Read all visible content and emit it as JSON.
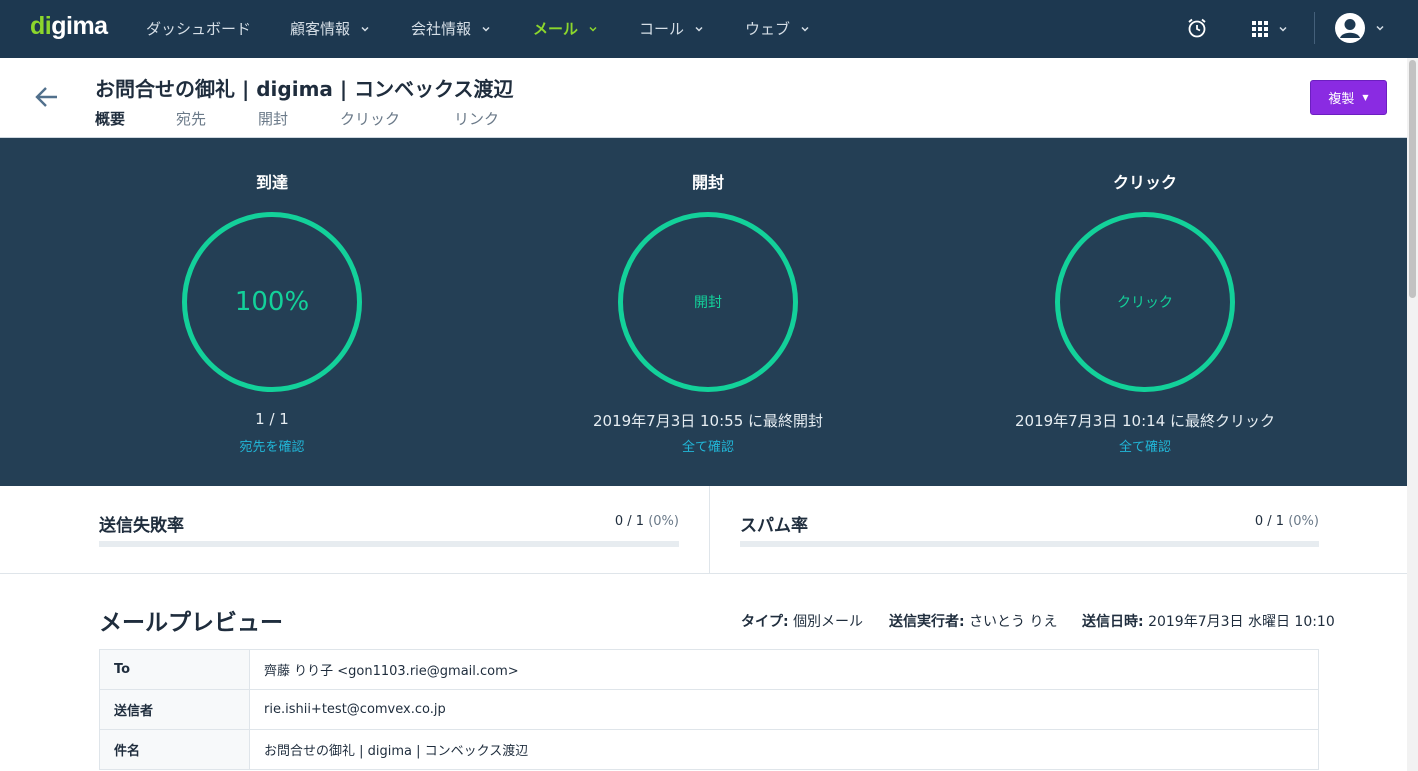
{
  "app": {
    "logo_prefix": "d",
    "logo_accent": "i",
    "logo_rest": "gima",
    "colors": {
      "nav_bg": "#1d3850",
      "accent_green": "#8cd72c",
      "ring": "#13d19a",
      "panel_bg": "#243f55",
      "button_purple": "#8a2be2",
      "link": "#21b6d7"
    }
  },
  "nav": {
    "items": [
      {
        "label": "ダッシュボード",
        "dropdown": false
      },
      {
        "label": "顧客情報",
        "dropdown": true
      },
      {
        "label": "会社情報",
        "dropdown": true
      },
      {
        "label": "メール",
        "dropdown": true,
        "active": true
      },
      {
        "label": "コール",
        "dropdown": true
      },
      {
        "label": "ウェブ",
        "dropdown": true
      }
    ],
    "icons": [
      "alarm-clock-icon",
      "apps-grid-icon",
      "chevron-down-icon",
      "user-avatar-icon",
      "chevron-down-icon"
    ]
  },
  "header": {
    "title": "お問合せの御礼 | digima | コンベックス渡辺",
    "tabs": [
      "概要",
      "宛先",
      "開封",
      "クリック",
      "リンク"
    ],
    "active_tab": "概要",
    "duplicate_button": "複製"
  },
  "stats": [
    {
      "title": "到達",
      "ring_label": "100%",
      "sub": "1 / 1",
      "link": "宛先を確認"
    },
    {
      "title": "開封",
      "ring_label": "開封",
      "sub": "2019年7月3日 10:55 に最終開封",
      "link": "全て確認"
    },
    {
      "title": "クリック",
      "ring_label": "クリック",
      "sub": "2019年7月3日 10:14 に最終クリック",
      "link": "全て確認"
    }
  ],
  "rates": [
    {
      "title": "送信失敗率",
      "value": "0 / 1",
      "percent": "(0%)",
      "fraction": 0
    },
    {
      "title": "スパム率",
      "value": "0 / 1",
      "percent": "(0%)",
      "fraction": 0
    }
  ],
  "preview": {
    "title": "メールプレビュー",
    "meta": [
      {
        "label": "タイプ:",
        "value": "個別メール"
      },
      {
        "label": "送信実行者:",
        "value": "さいとう りえ"
      },
      {
        "label": "送信日時:",
        "value": "2019年7月3日 水曜日 10:10"
      }
    ],
    "rows": [
      {
        "key": "To",
        "value": "齊藤 りり子 <gon1103.rie@gmail.com>"
      },
      {
        "key": "送信者",
        "value": "rie.ishii+test@comvex.co.jp"
      },
      {
        "key": "件名",
        "value": "お問合せの御礼 | digima | コンベックス渡辺"
      }
    ]
  }
}
